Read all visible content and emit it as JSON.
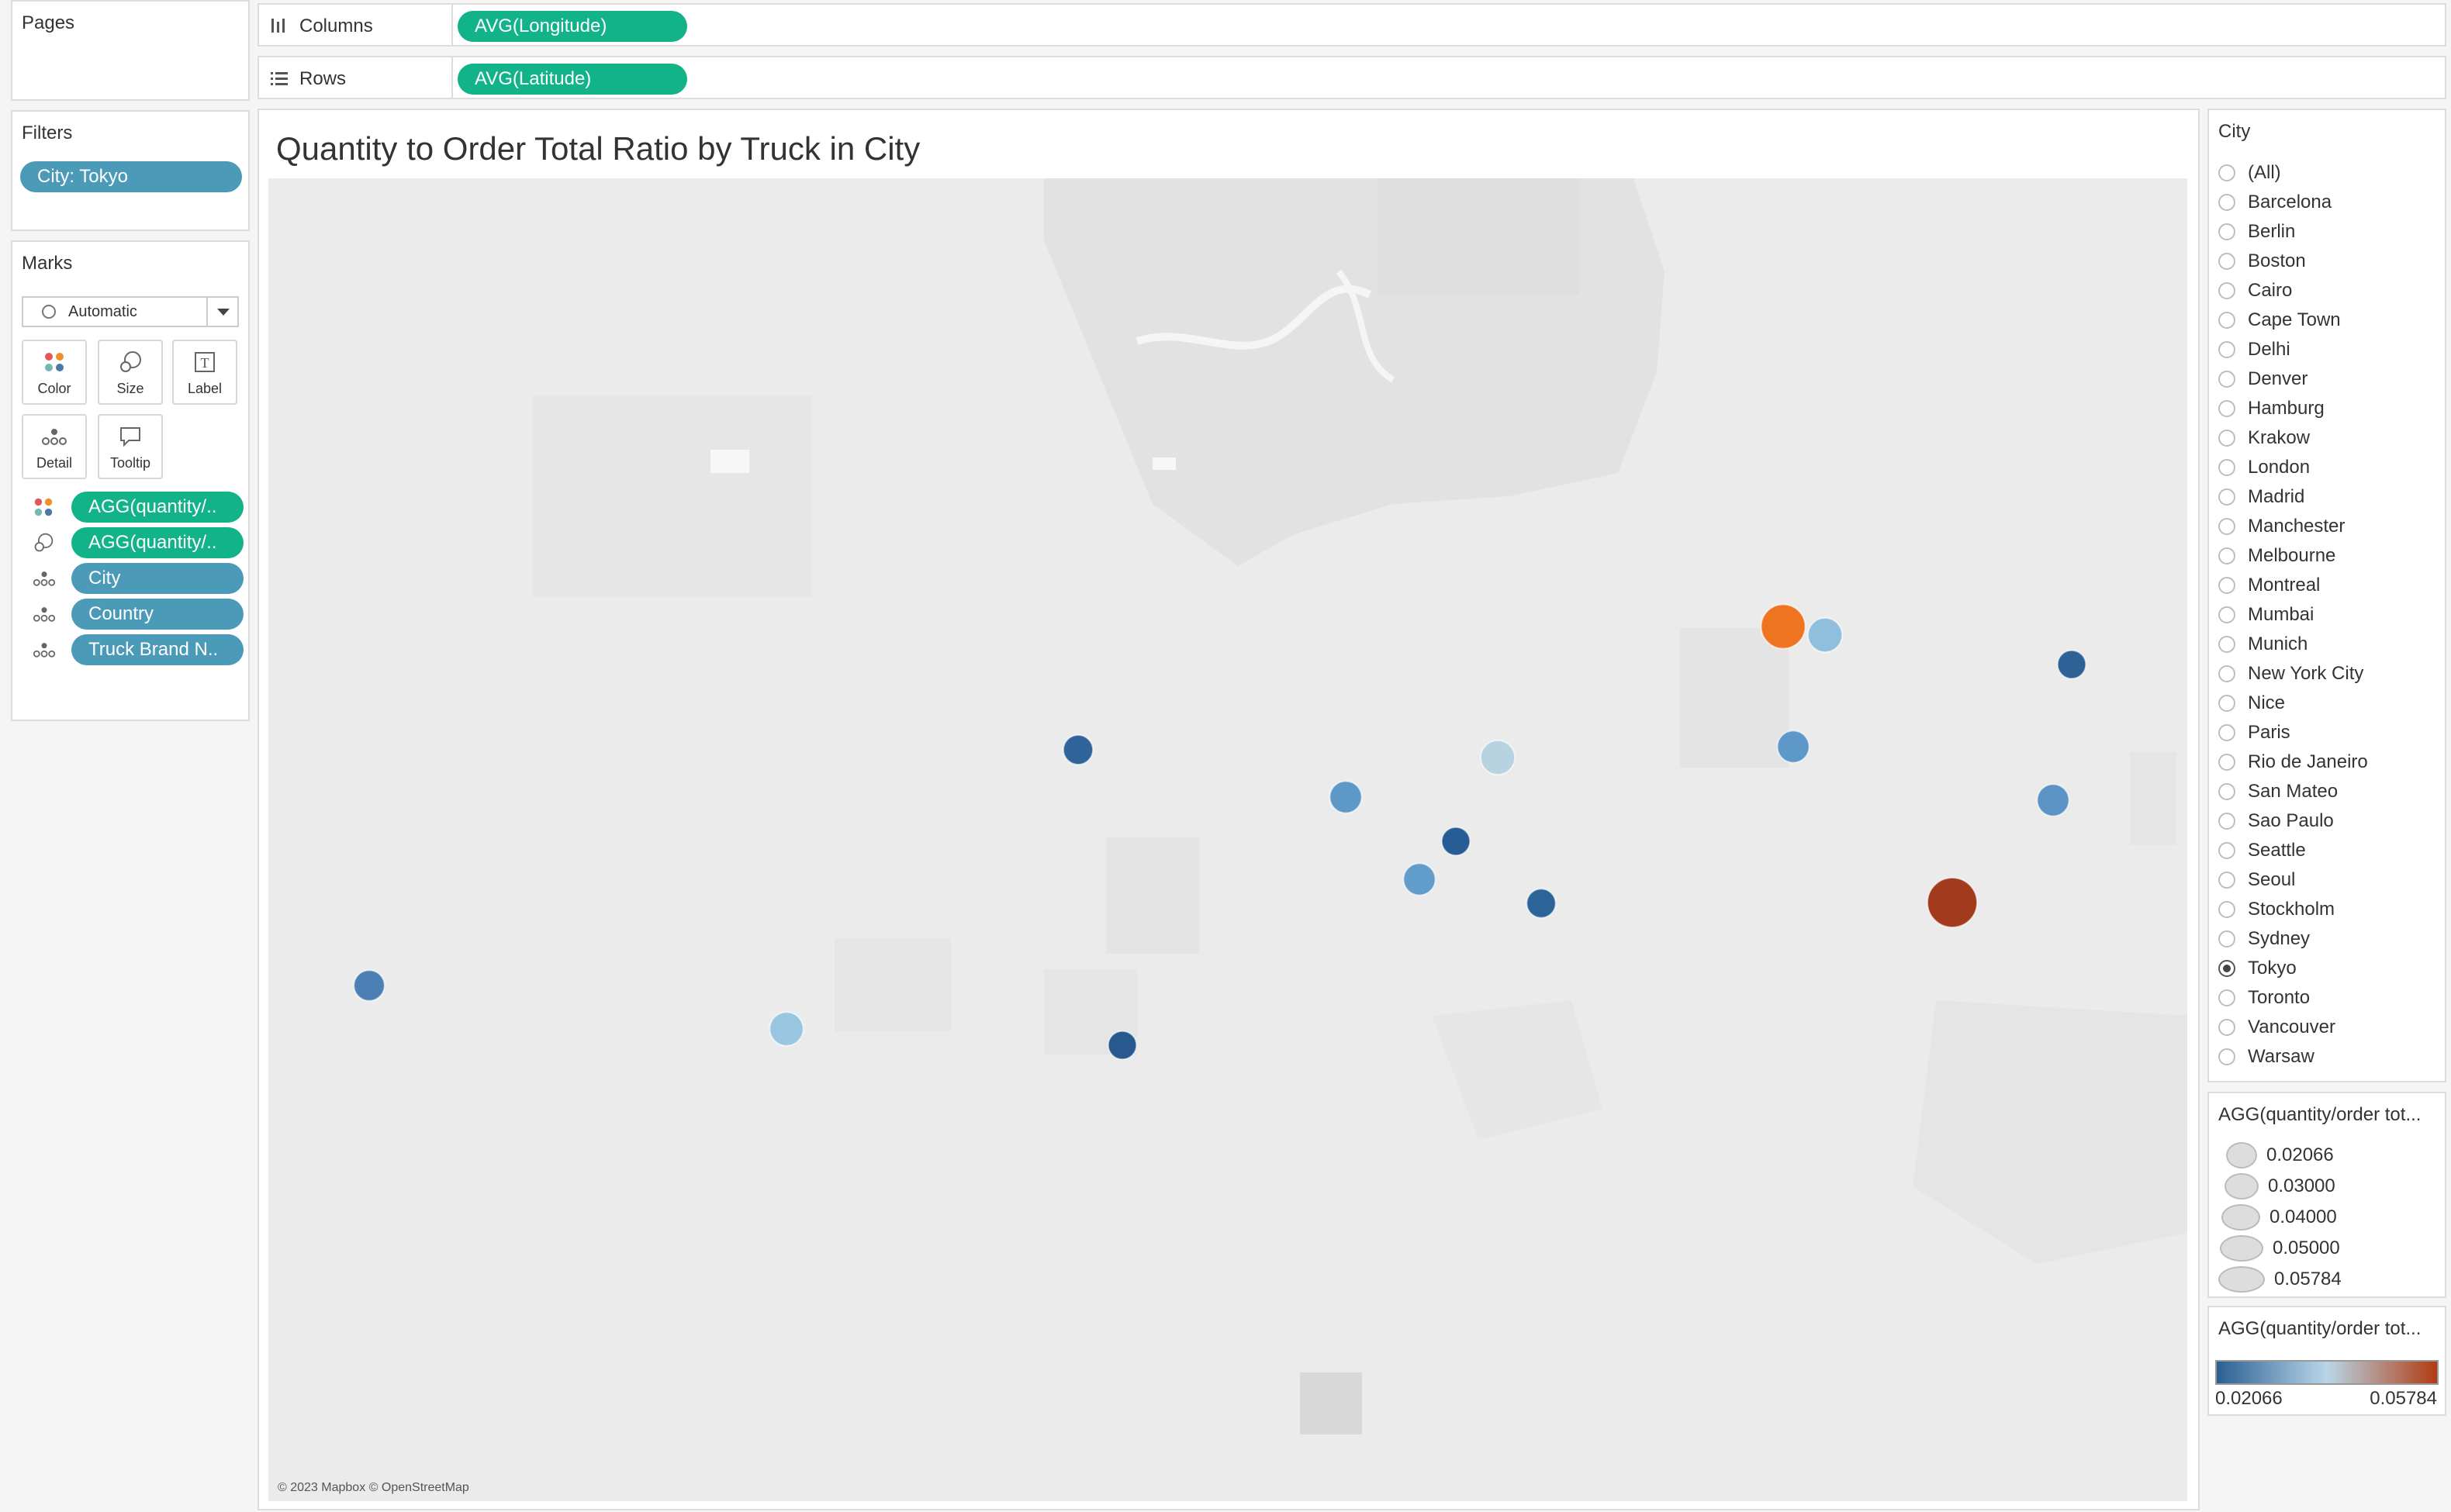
{
  "pages": {
    "title": "Pages"
  },
  "shelves": {
    "columns": {
      "label": "Columns",
      "pill": "AVG(Longitude)"
    },
    "rows": {
      "label": "Rows",
      "pill": "AVG(Latitude)"
    }
  },
  "filters": {
    "title": "Filters",
    "pill": "City: Tokyo"
  },
  "marks": {
    "title": "Marks",
    "type": "Automatic",
    "cards": {
      "color": "Color",
      "size": "Size",
      "label": "Label",
      "detail": "Detail",
      "tooltip": "Tooltip"
    },
    "fields": [
      {
        "label": "AGG(quantity/..",
        "kind": "green",
        "icon": "color-dots-icon"
      },
      {
        "label": "AGG(quantity/..",
        "kind": "green",
        "icon": "size-icon"
      },
      {
        "label": "City",
        "kind": "blue",
        "icon": "detail-icon"
      },
      {
        "label": "Country",
        "kind": "blue",
        "icon": "detail-icon"
      },
      {
        "label": "Truck Brand N..",
        "kind": "blue",
        "icon": "detail-icon"
      }
    ]
  },
  "viz": {
    "title": "Quantity to Order Total Ratio by Truck in City",
    "attribution": "© 2023 Mapbox © OpenStreetMap"
  },
  "city_filter": {
    "title": "City",
    "selected": "Tokyo",
    "options": [
      "(All)",
      "Barcelona",
      "Berlin",
      "Boston",
      "Cairo",
      "Cape Town",
      "Delhi",
      "Denver",
      "Hamburg",
      "Krakow",
      "London",
      "Madrid",
      "Manchester",
      "Melbourne",
      "Montreal",
      "Mumbai",
      "Munich",
      "New York City",
      "Nice",
      "Paris",
      "Rio de Janeiro",
      "San Mateo",
      "Sao Paulo",
      "Seattle",
      "Seoul",
      "Stockholm",
      "Sydney",
      "Tokyo",
      "Toronto",
      "Vancouver",
      "Warsaw"
    ]
  },
  "size_legend": {
    "title": "AGG(quantity/order tot...",
    "items": [
      "0.02066",
      "0.03000",
      "0.04000",
      "0.05000",
      "0.05784"
    ]
  },
  "color_legend": {
    "title": "AGG(quantity/order tot...",
    "min_label": "0.02066",
    "max_label": "0.05784",
    "colors": {
      "low": "#2b5f93",
      "mid": "#b9d6e8",
      "high": "#b13b12"
    }
  },
  "chart_data": {
    "type": "scatter",
    "title": "Quantity to Order Total Ratio by Truck in City",
    "xlabel": "AVG(Longitude)",
    "ylabel": "AVG(Latitude)",
    "value_range": [
      0.02066,
      0.05784
    ],
    "points": [
      {
        "value": 0.0485,
        "color": "#ee7422"
      },
      {
        "value": 0.0315,
        "color": "#8fbfdd"
      },
      {
        "value": 0.0215,
        "color": "#2e6196"
      },
      {
        "value": 0.0235,
        "color": "#2f639a"
      },
      {
        "value": 0.0315,
        "color": "#b7d3e2"
      },
      {
        "value": 0.0275,
        "color": "#5e98c7"
      },
      {
        "value": 0.0275,
        "color": "#5b94c4"
      },
      {
        "value": 0.0275,
        "color": "#5e98c8"
      },
      {
        "value": 0.0215,
        "color": "#275d94"
      },
      {
        "value": 0.0275,
        "color": "#629ccb"
      },
      {
        "value": 0.0225,
        "color": "#2c6399"
      },
      {
        "value": 0.0578,
        "color": "#a23a1e"
      },
      {
        "value": 0.0255,
        "color": "#4c7fb4"
      },
      {
        "value": 0.0305,
        "color": "#98c6e0"
      },
      {
        "value": 0.0215,
        "color": "#27598f"
      }
    ]
  }
}
